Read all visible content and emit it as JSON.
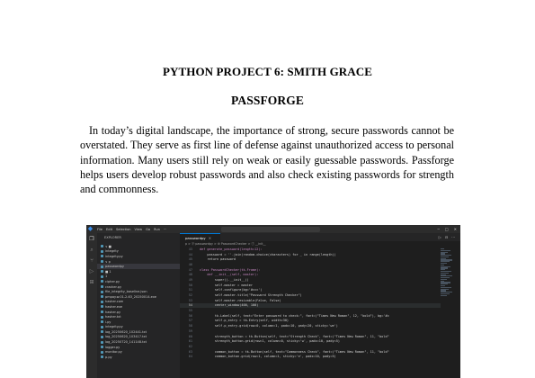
{
  "document": {
    "title": "PYTHON PROJECT 6: SMITH GRACE",
    "subtitle": "PASSFORGE",
    "paragraph": "In today’s digital landscape, the importance of strong, secure passwords cannot be overstated. They serve as first line of defense against unauthorized access to personal information. Many users still rely on weak or easily guessable passwords. Passforge helps users develop robust passwords and also check existing passwords for strength and commonness."
  },
  "ide": {
    "menu": [
      "File",
      "Edit",
      "Selection",
      "View",
      "Go",
      "Run",
      "···"
    ],
    "sidebar_header": "EXPLORER",
    "files": [
      "∨ ■",
      "  integrity",
      "  integrity.py",
      "  ∨ p",
      "  passwordpy",
      "  ■ 1",
      "  1",
      "  cipher.py",
      "  cracker.py",
      "  file_integrity_baseline.json",
      "  pmpay.w.01-2-63_20250014.exe",
      "  hasher.com",
      "  hasher.exe",
      "  hasher.py",
      "  hasher.txt",
      "  i.py",
      "  integrity.py",
      "  log_20250620_102441.txt",
      "  log_20250620_103417.txt",
      "  log_20250720_141148.txt",
      "  logger.py",
      "  monitor.py",
      "  p.py"
    ],
    "active_tab": "passwordpy",
    "breadcrumb": "p > ⓟ passwordpy > ⚙ PasswordChecker > ⓕ __init__",
    "code_lines": [
      {
        "no": "43",
        "text": "def generate_password(length=12):"
      },
      {
        "no": "44",
        "text": "    password = ''.join(random.choice(characters) for _ in range(length))"
      },
      {
        "no": "45",
        "text": "    return password"
      },
      {
        "no": "46",
        "text": ""
      },
      {
        "no": "47",
        "text": "class PasswordChecker(tk.Frame):"
      },
      {
        "no": "48",
        "text": "    def __init__(self, master):"
      },
      {
        "no": "49",
        "text": "        super().__init__()"
      },
      {
        "no": "50",
        "text": "        self.master = master"
      },
      {
        "no": "51",
        "text": "        self.configure(bg='#ccc')"
      },
      {
        "no": "52",
        "text": "        self.master.title(\"Password Strength Checker\")"
      },
      {
        "no": "53",
        "text": "        self.master.resizable(False, False)"
      },
      {
        "no": "54",
        "text": "        center_window(400, 100)"
      },
      {
        "no": "55",
        "text": ""
      },
      {
        "no": "56",
        "text": "        tk.Label(self, text=\"Enter password to check:\", font=(\"Times New Roman\", 12, \"bold\"), bg='#c"
      },
      {
        "no": "57",
        "text": "        self.p_entry = tk.Entry(self, width=30)"
      },
      {
        "no": "58",
        "text": "        self.p_entry.grid(row=0, column=1, padx=10, pady=20, sticky='we')"
      },
      {
        "no": "59",
        "text": ""
      },
      {
        "no": "60",
        "text": "        strength_button = tk.Button(self, text=\"Strength Check\", font=(\"Times New Roman\", 11, \"bold\""
      },
      {
        "no": "61",
        "text": "        strength_button.grid(row=1, column=0, sticky='w', padx=10, pady=5)"
      },
      {
        "no": "62",
        "text": ""
      },
      {
        "no": "63",
        "text": "        common_button = tk.Button(self, text=\"Commonness Check\", font=(\"Times New Roman\", 11, \"bold\""
      },
      {
        "no": "64",
        "text": "        common_button.grid(row=1, column=1, sticky='e', padx=10, pady=5)"
      }
    ]
  }
}
